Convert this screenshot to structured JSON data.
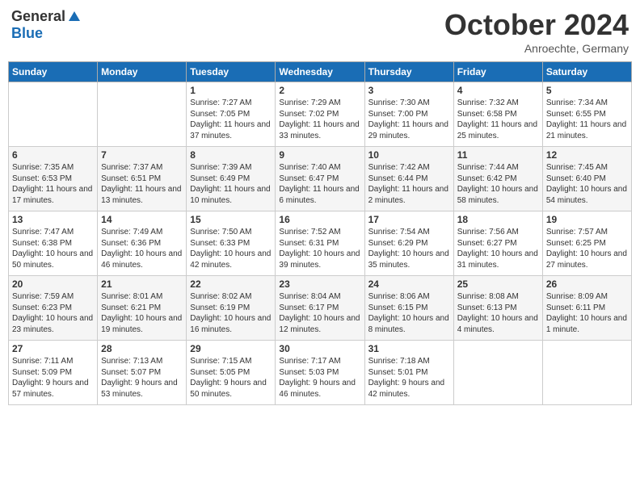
{
  "logo": {
    "general": "General",
    "blue": "Blue"
  },
  "header": {
    "month": "October 2024",
    "location": "Anroechte, Germany"
  },
  "weekdays": [
    "Sunday",
    "Monday",
    "Tuesday",
    "Wednesday",
    "Thursday",
    "Friday",
    "Saturday"
  ],
  "weeks": [
    [
      {
        "day": "",
        "sunrise": "",
        "sunset": "",
        "daylight": ""
      },
      {
        "day": "",
        "sunrise": "",
        "sunset": "",
        "daylight": ""
      },
      {
        "day": "1",
        "sunrise": "Sunrise: 7:27 AM",
        "sunset": "Sunset: 7:05 PM",
        "daylight": "Daylight: 11 hours and 37 minutes."
      },
      {
        "day": "2",
        "sunrise": "Sunrise: 7:29 AM",
        "sunset": "Sunset: 7:02 PM",
        "daylight": "Daylight: 11 hours and 33 minutes."
      },
      {
        "day": "3",
        "sunrise": "Sunrise: 7:30 AM",
        "sunset": "Sunset: 7:00 PM",
        "daylight": "Daylight: 11 hours and 29 minutes."
      },
      {
        "day": "4",
        "sunrise": "Sunrise: 7:32 AM",
        "sunset": "Sunset: 6:58 PM",
        "daylight": "Daylight: 11 hours and 25 minutes."
      },
      {
        "day": "5",
        "sunrise": "Sunrise: 7:34 AM",
        "sunset": "Sunset: 6:55 PM",
        "daylight": "Daylight: 11 hours and 21 minutes."
      }
    ],
    [
      {
        "day": "6",
        "sunrise": "Sunrise: 7:35 AM",
        "sunset": "Sunset: 6:53 PM",
        "daylight": "Daylight: 11 hours and 17 minutes."
      },
      {
        "day": "7",
        "sunrise": "Sunrise: 7:37 AM",
        "sunset": "Sunset: 6:51 PM",
        "daylight": "Daylight: 11 hours and 13 minutes."
      },
      {
        "day": "8",
        "sunrise": "Sunrise: 7:39 AM",
        "sunset": "Sunset: 6:49 PM",
        "daylight": "Daylight: 11 hours and 10 minutes."
      },
      {
        "day": "9",
        "sunrise": "Sunrise: 7:40 AM",
        "sunset": "Sunset: 6:47 PM",
        "daylight": "Daylight: 11 hours and 6 minutes."
      },
      {
        "day": "10",
        "sunrise": "Sunrise: 7:42 AM",
        "sunset": "Sunset: 6:44 PM",
        "daylight": "Daylight: 11 hours and 2 minutes."
      },
      {
        "day": "11",
        "sunrise": "Sunrise: 7:44 AM",
        "sunset": "Sunset: 6:42 PM",
        "daylight": "Daylight: 10 hours and 58 minutes."
      },
      {
        "day": "12",
        "sunrise": "Sunrise: 7:45 AM",
        "sunset": "Sunset: 6:40 PM",
        "daylight": "Daylight: 10 hours and 54 minutes."
      }
    ],
    [
      {
        "day": "13",
        "sunrise": "Sunrise: 7:47 AM",
        "sunset": "Sunset: 6:38 PM",
        "daylight": "Daylight: 10 hours and 50 minutes."
      },
      {
        "day": "14",
        "sunrise": "Sunrise: 7:49 AM",
        "sunset": "Sunset: 6:36 PM",
        "daylight": "Daylight: 10 hours and 46 minutes."
      },
      {
        "day": "15",
        "sunrise": "Sunrise: 7:50 AM",
        "sunset": "Sunset: 6:33 PM",
        "daylight": "Daylight: 10 hours and 42 minutes."
      },
      {
        "day": "16",
        "sunrise": "Sunrise: 7:52 AM",
        "sunset": "Sunset: 6:31 PM",
        "daylight": "Daylight: 10 hours and 39 minutes."
      },
      {
        "day": "17",
        "sunrise": "Sunrise: 7:54 AM",
        "sunset": "Sunset: 6:29 PM",
        "daylight": "Daylight: 10 hours and 35 minutes."
      },
      {
        "day": "18",
        "sunrise": "Sunrise: 7:56 AM",
        "sunset": "Sunset: 6:27 PM",
        "daylight": "Daylight: 10 hours and 31 minutes."
      },
      {
        "day": "19",
        "sunrise": "Sunrise: 7:57 AM",
        "sunset": "Sunset: 6:25 PM",
        "daylight": "Daylight: 10 hours and 27 minutes."
      }
    ],
    [
      {
        "day": "20",
        "sunrise": "Sunrise: 7:59 AM",
        "sunset": "Sunset: 6:23 PM",
        "daylight": "Daylight: 10 hours and 23 minutes."
      },
      {
        "day": "21",
        "sunrise": "Sunrise: 8:01 AM",
        "sunset": "Sunset: 6:21 PM",
        "daylight": "Daylight: 10 hours and 19 minutes."
      },
      {
        "day": "22",
        "sunrise": "Sunrise: 8:02 AM",
        "sunset": "Sunset: 6:19 PM",
        "daylight": "Daylight: 10 hours and 16 minutes."
      },
      {
        "day": "23",
        "sunrise": "Sunrise: 8:04 AM",
        "sunset": "Sunset: 6:17 PM",
        "daylight": "Daylight: 10 hours and 12 minutes."
      },
      {
        "day": "24",
        "sunrise": "Sunrise: 8:06 AM",
        "sunset": "Sunset: 6:15 PM",
        "daylight": "Daylight: 10 hours and 8 minutes."
      },
      {
        "day": "25",
        "sunrise": "Sunrise: 8:08 AM",
        "sunset": "Sunset: 6:13 PM",
        "daylight": "Daylight: 10 hours and 4 minutes."
      },
      {
        "day": "26",
        "sunrise": "Sunrise: 8:09 AM",
        "sunset": "Sunset: 6:11 PM",
        "daylight": "Daylight: 10 hours and 1 minute."
      }
    ],
    [
      {
        "day": "27",
        "sunrise": "Sunrise: 7:11 AM",
        "sunset": "Sunset: 5:09 PM",
        "daylight": "Daylight: 9 hours and 57 minutes."
      },
      {
        "day": "28",
        "sunrise": "Sunrise: 7:13 AM",
        "sunset": "Sunset: 5:07 PM",
        "daylight": "Daylight: 9 hours and 53 minutes."
      },
      {
        "day": "29",
        "sunrise": "Sunrise: 7:15 AM",
        "sunset": "Sunset: 5:05 PM",
        "daylight": "Daylight: 9 hours and 50 minutes."
      },
      {
        "day": "30",
        "sunrise": "Sunrise: 7:17 AM",
        "sunset": "Sunset: 5:03 PM",
        "daylight": "Daylight: 9 hours and 46 minutes."
      },
      {
        "day": "31",
        "sunrise": "Sunrise: 7:18 AM",
        "sunset": "Sunset: 5:01 PM",
        "daylight": "Daylight: 9 hours and 42 minutes."
      },
      {
        "day": "",
        "sunrise": "",
        "sunset": "",
        "daylight": ""
      },
      {
        "day": "",
        "sunrise": "",
        "sunset": "",
        "daylight": ""
      }
    ]
  ]
}
